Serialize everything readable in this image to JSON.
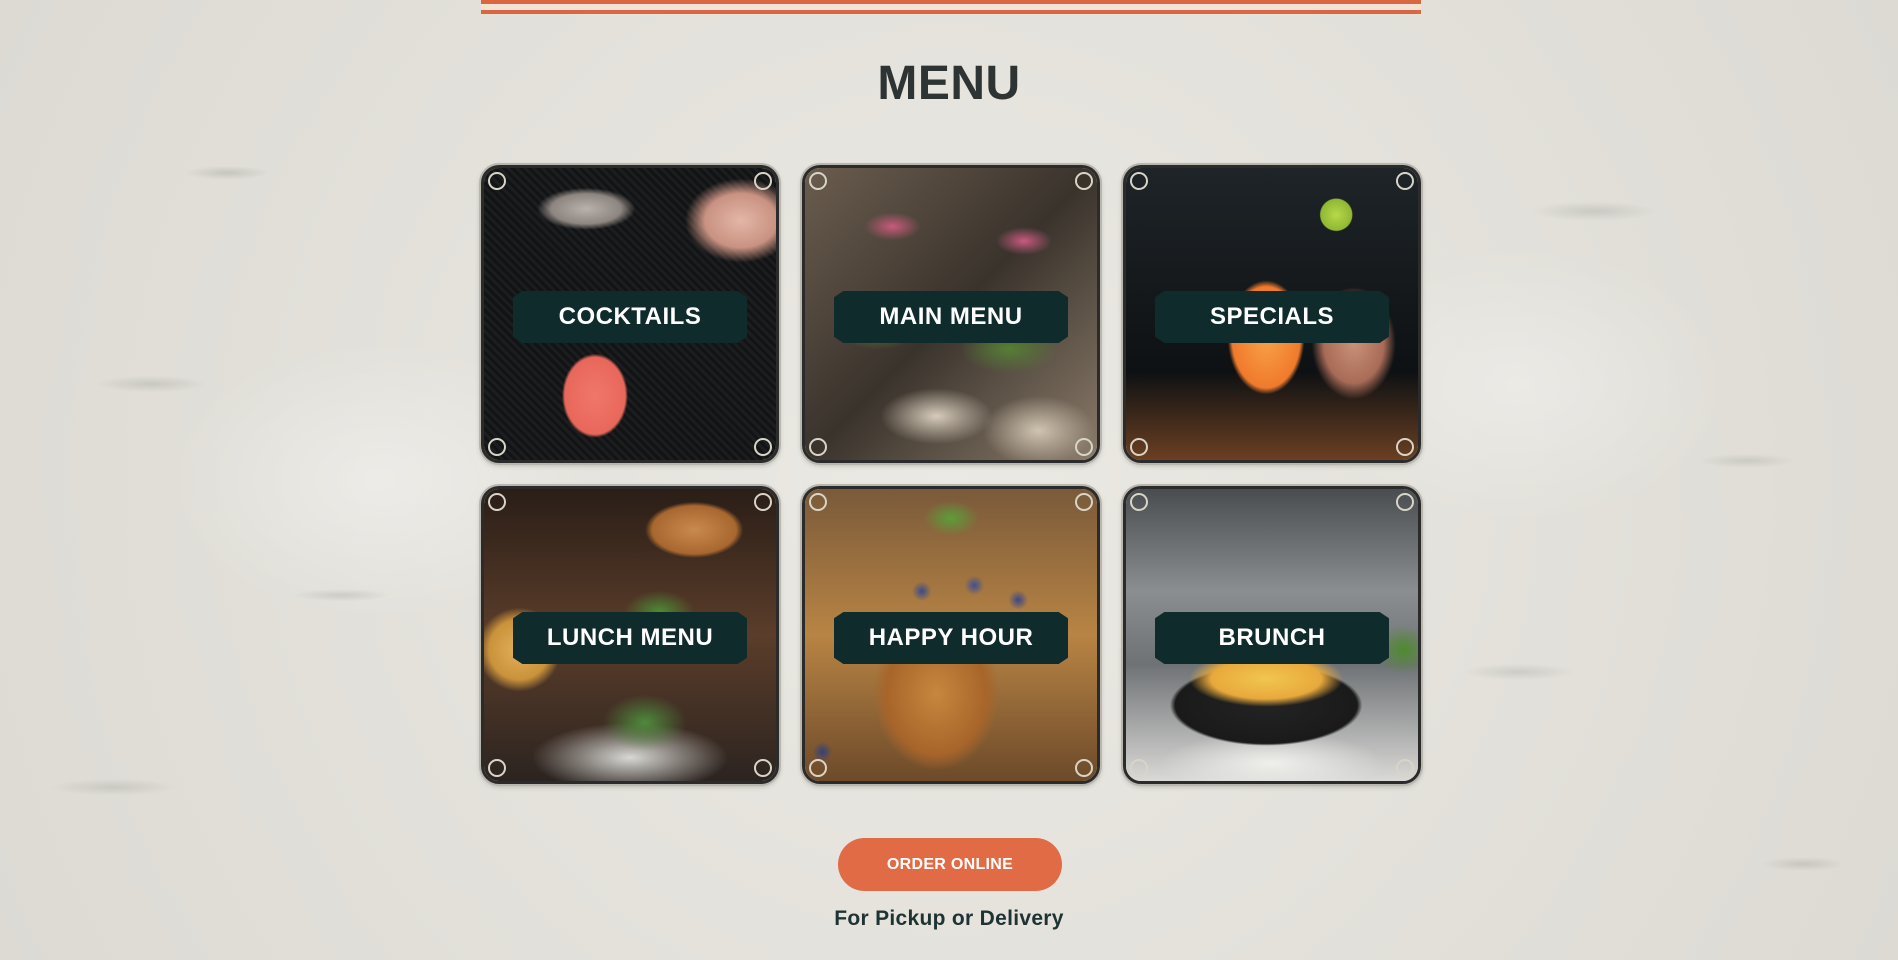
{
  "page": {
    "title": "MENU",
    "colors": {
      "accent": "#e06b45",
      "label_bg": "#0f2b2c",
      "title": "#2e3333"
    }
  },
  "menu_cards": [
    {
      "label": "COCKTAILS",
      "image": "cocktail being strained into glass"
    },
    {
      "label": "MAIN MENU",
      "image": "tacos with pickled onions and herbs"
    },
    {
      "label": "SPECIALS",
      "image": "orange drink with lime wedge"
    },
    {
      "label": "LUNCH MENU",
      "image": "burger with fries and salad"
    },
    {
      "label": "HAPPY HOUR",
      "image": "french toast with blueberries and mint"
    },
    {
      "label": "BRUNCH",
      "image": "skillet dish with eggs and herbs"
    }
  ],
  "cta": {
    "button_label": "ORDER ONLINE",
    "subtext": "For Pickup or Delivery"
  }
}
